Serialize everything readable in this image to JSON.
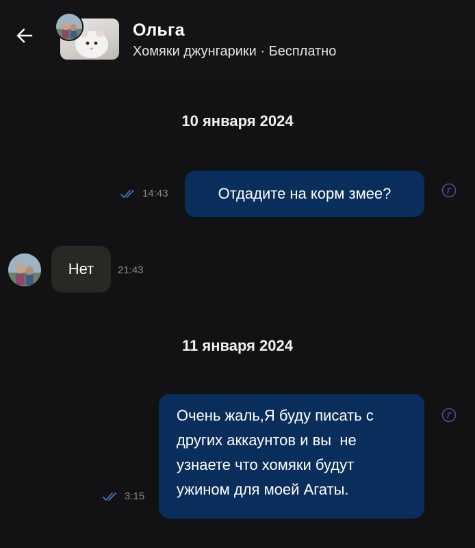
{
  "header": {
    "back_icon": "arrow-left-icon",
    "name": "Ольга",
    "subtitle": "Хомяки джунгарики · Бесплатно"
  },
  "conversation": [
    {
      "type": "date",
      "text": "10 января 2024"
    },
    {
      "type": "message",
      "direction": "outgoing",
      "text": "Отдадите на корм змее?",
      "time": "14:43",
      "status_icon": "double-check-icon"
    },
    {
      "type": "message",
      "direction": "incoming",
      "text": "Нет",
      "time": "21:43"
    },
    {
      "type": "date",
      "text": "11 января 2024"
    },
    {
      "type": "message",
      "direction": "outgoing",
      "lines": [
        "Очень жаль,Я буду писать с",
        "других аккаунтов и вы  не",
        "узнаете что хомяки будут",
        "ужином для моей Агаты."
      ],
      "time": "3:15",
      "status_icon": "double-check-icon"
    }
  ],
  "colors": {
    "background": "#121214",
    "outgoing_bubble": "#0a2e5c",
    "incoming_bubble": "#2a2824",
    "meta_text": "#8a8a8e",
    "read_check": "#4a7fd6"
  }
}
